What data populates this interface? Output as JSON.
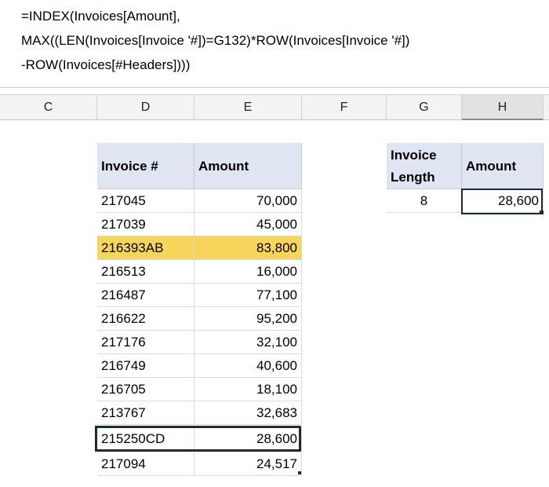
{
  "formula": {
    "line1": "=INDEX(Invoices[Amount],",
    "line2": "MAX((LEN(Invoices[Invoice '#])=G132)*ROW(Invoices[Invoice '#])",
    "line3": "-ROW(Invoices[#Headers])))"
  },
  "columns": [
    "C",
    "D",
    "E",
    "F",
    "G",
    "H"
  ],
  "selected_column": "H",
  "invoices": {
    "headers": [
      "Invoice #",
      "Amount"
    ],
    "rows": [
      {
        "invoice": "217045",
        "amount": "70,000"
      },
      {
        "invoice": "217039",
        "amount": "45,000"
      },
      {
        "invoice": "216393AB",
        "amount": "83,800"
      },
      {
        "invoice": "216513",
        "amount": "16,000"
      },
      {
        "invoice": "216487",
        "amount": "77,100"
      },
      {
        "invoice": "216622",
        "amount": "95,200"
      },
      {
        "invoice": "217176",
        "amount": "32,100"
      },
      {
        "invoice": "216749",
        "amount": "40,600"
      },
      {
        "invoice": "216705",
        "amount": "18,100"
      },
      {
        "invoice": "213767",
        "amount": "32,683"
      },
      {
        "invoice": "215250CD",
        "amount": "28,600"
      },
      {
        "invoice": "217094",
        "amount": "24,517"
      }
    ]
  },
  "lookup": {
    "header_length_line1": "Invoice",
    "header_length_line2": "Length",
    "header_amount": "Amount",
    "length": "8",
    "amount": "28,600"
  },
  "colors": {
    "header_fill": "#dfe6f1",
    "highlight_fill": "#f7d55a",
    "outline": "#1e2a38"
  }
}
